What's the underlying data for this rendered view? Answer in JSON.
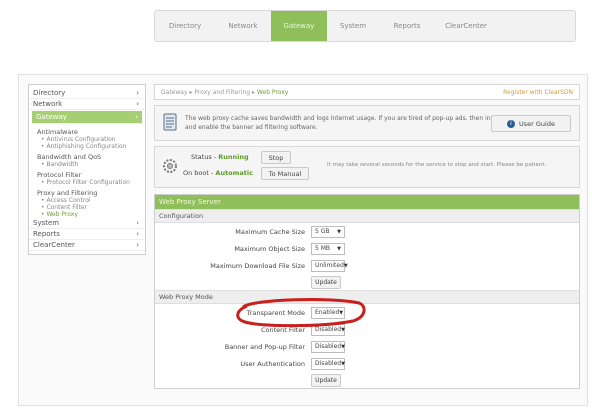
{
  "topnav": {
    "tabs": [
      "Directory",
      "Network",
      "Gateway",
      "System",
      "Reports",
      "ClearCenter"
    ],
    "active": "Gateway"
  },
  "sidebar": {
    "directory": "Directory",
    "network": "Network",
    "gateway": "Gateway",
    "antimalware": "Antimalware",
    "antivirus": "• Antivirus Configuration",
    "antiphishing": "• Antiphishing Configuration",
    "bandwidth_qos": "Bandwidth and QoS",
    "bandwidth": "• Bandwidth",
    "protocol_filter": "Protocol Filter",
    "protocol_filter_conf": "• Protocol Filter Configuration",
    "proxy_filtering": "Proxy and Filtering",
    "access_control": "• Access Control",
    "content_filter": "• Content Filter",
    "web_proxy": "• Web Proxy",
    "system": "System",
    "reports": "Reports",
    "clearcenter": "ClearCenter",
    "arrow": "›"
  },
  "breadcrumb": {
    "p1": "Gateway",
    "p2": "Proxy and Filtering",
    "current": "Web Proxy",
    "sep": "▸",
    "register": "Register with ClearSDN"
  },
  "info": {
    "text": "The web proxy cache saves bandwidth and logs Internet usage.  If you are tired of pop-up ads, then install and enable the banner ad filtering software.",
    "user_guide": "User Guide"
  },
  "status": {
    "status_label": "Status -",
    "status_value": "Running",
    "stop": "Stop",
    "onboot_label": "On boot -",
    "onboot_value": "Automatic",
    "to_manual": "To Manual",
    "note": "It may take several seconds for the service to stop and start.  Please be patient."
  },
  "server": {
    "title": "Web Proxy Server",
    "configuration": "Configuration",
    "max_cache_label": "Maximum Cache Size",
    "max_cache_value": "5 GB",
    "max_object_label": "Maximum Object Size",
    "max_object_value": "5 MB",
    "max_download_label": "Maximum Download File Size",
    "max_download_value": "Unlimited",
    "update": "Update",
    "mode": "Web Proxy Mode",
    "transparent_label": "Transparent Mode",
    "transparent_value": "Enabled",
    "content_filter_label": "Content Filter",
    "content_filter_value": "Disabled",
    "banner_label": "Banner and Pop-up Filter",
    "banner_value": "Disabled",
    "auth_label": "User Authentication",
    "auth_value": "Disabled",
    "update2": "Update"
  },
  "colors": {
    "accent": "#8fbf5a",
    "highlight_circle": "#c8201c"
  }
}
